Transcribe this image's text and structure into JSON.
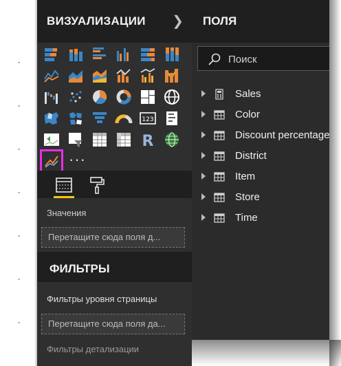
{
  "visualizations": {
    "title": "ВИЗУАЛИЗАЦИИ",
    "collapse_icon": "chevron-right-icon",
    "selected_visual": "line-and-column-chart-icon",
    "more_label": "···",
    "tabs": [
      "fields-tab-icon",
      "format-paint-roller-icon"
    ],
    "values_label": "Значения",
    "values_placeholder": "Перетащите сюда поля д..."
  },
  "filters": {
    "title": "ФИЛЬТРЫ",
    "page_level_label": "Фильтры уровня страницы",
    "page_level_placeholder": "Перетащите сюда поля да...",
    "drillthrough_label": "Фильтры детализации"
  },
  "fields": {
    "title": "ПОЛЯ",
    "search_placeholder": "Поиск",
    "items": [
      {
        "label": "Sales",
        "icon": "calculator-icon"
      },
      {
        "label": "Color",
        "icon": "table-icon"
      },
      {
        "label": "Discount percentage",
        "icon": "table-icon"
      },
      {
        "label": "District",
        "icon": "table-icon"
      },
      {
        "label": "Item",
        "icon": "table-icon"
      },
      {
        "label": "Store",
        "icon": "table-icon"
      },
      {
        "label": "Time",
        "icon": "table-icon"
      }
    ]
  },
  "colors": {
    "accent_yellow": "#f2c811",
    "selection_magenta": "#e62ee6",
    "pane_dark": "#2f2f2f",
    "header_dark": "#1f1f1f"
  }
}
